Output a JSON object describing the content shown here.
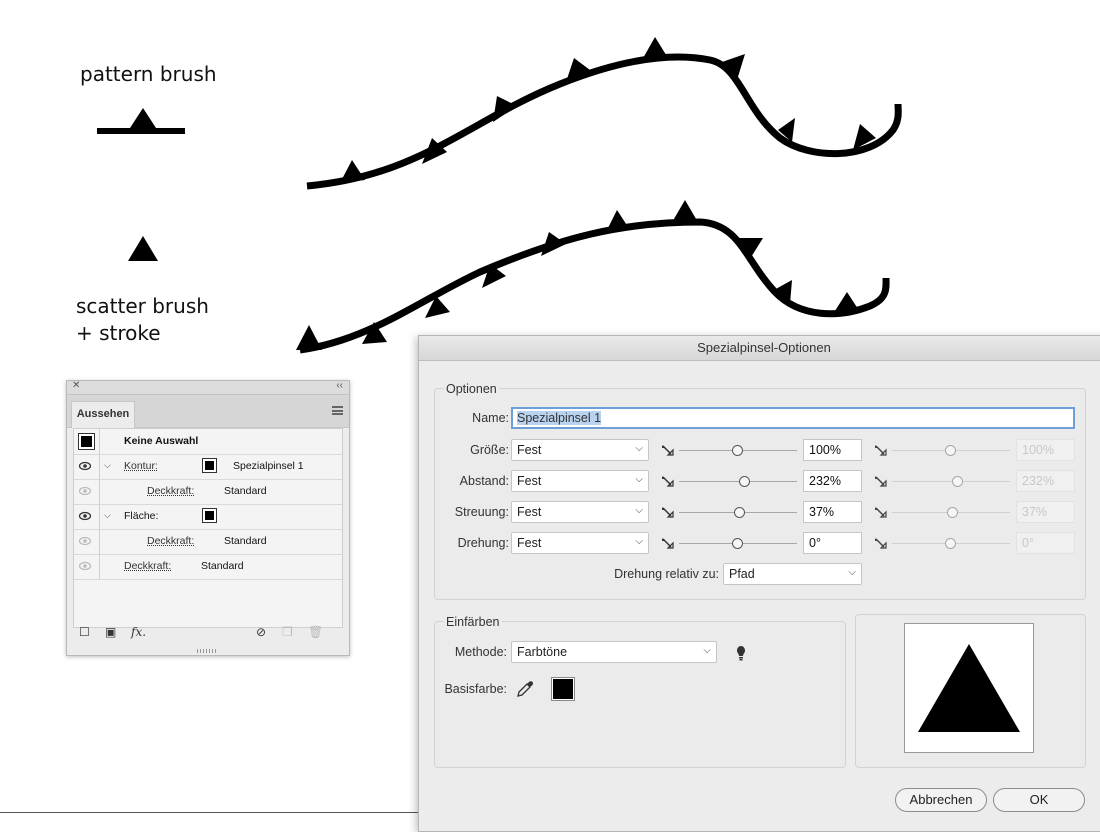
{
  "canvas": {
    "pattern_label": "pattern brush",
    "scatter_label_line1": "scatter brush",
    "scatter_label_line2": "+ stroke"
  },
  "appearance_panel": {
    "tab_label": "Aussehen",
    "rows": [
      {
        "label": "Keine Auswahl"
      },
      {
        "label": "Kontur:",
        "value": "Spezialpinsel 1"
      },
      {
        "label": "Deckkraft:",
        "value": "Standard"
      },
      {
        "label": "Fläche:"
      },
      {
        "label": "Deckkraft:",
        "value": "Standard"
      },
      {
        "label": "Deckkraft:",
        "value": "Standard"
      }
    ],
    "footer_icons": [
      "new-stroke-icon",
      "new-fill-icon",
      "fx-icon",
      "clear-appearance-icon",
      "duplicate-item-icon",
      "delete-item-icon"
    ]
  },
  "dialog": {
    "title": "Spezialpinsel-Optionen",
    "options_group": "Optionen",
    "name_label": "Name:",
    "name_value": "Spezialpinsel 1",
    "rows": [
      {
        "label": "Größe:",
        "mode": "Fest",
        "value": "100%",
        "value2": "100%",
        "level": 0.5
      },
      {
        "label": "Abstand:",
        "mode": "Fest",
        "value": "232%",
        "value2": "232%",
        "level": 0.56
      },
      {
        "label": "Streuung:",
        "mode": "Fest",
        "value": "37%",
        "value2": "37%",
        "level": 0.52
      },
      {
        "label": "Drehung:",
        "mode": "Fest",
        "value": "0°",
        "value2": "0°",
        "level": 0.5
      }
    ],
    "rotation_relative_label": "Drehung relativ zu:",
    "rotation_relative_value": "Pfad",
    "colorize_group": "Einfärben",
    "method_label": "Methode:",
    "method_value": "Farbtöne",
    "key_color_label": "Basisfarbe:",
    "key_color": "#000000",
    "cancel_label": "Abbrechen",
    "ok_label": "OK"
  }
}
